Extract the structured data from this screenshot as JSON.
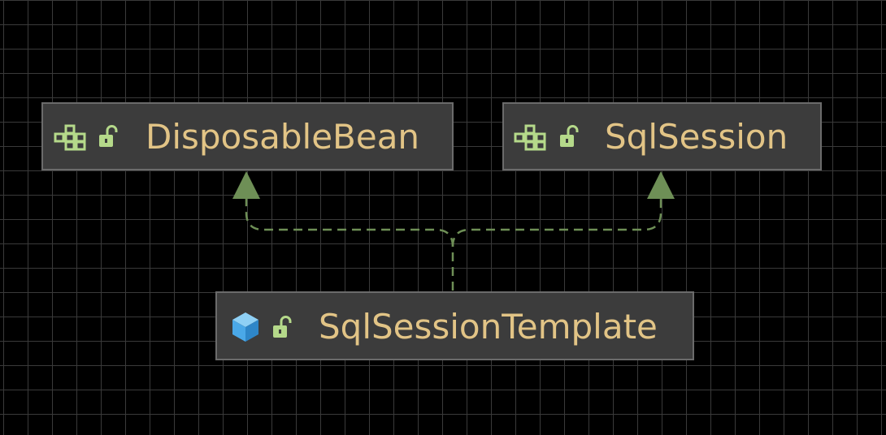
{
  "diagram": {
    "type": "uml-class-hierarchy",
    "nodes": [
      {
        "id": "disposable",
        "name": "DisposableBean",
        "kind": "interface",
        "kind_icon": "interface-icon",
        "visibility_icon": "unlocked-icon"
      },
      {
        "id": "sqlsession",
        "name": "SqlSession",
        "kind": "interface",
        "kind_icon": "interface-icon",
        "visibility_icon": "unlocked-icon"
      },
      {
        "id": "template",
        "name": "SqlSessionTemplate",
        "kind": "class",
        "kind_icon": "class-cube-icon",
        "visibility_icon": "unlocked-icon"
      }
    ],
    "edges": [
      {
        "from": "template",
        "to": "disposable",
        "relation": "implements",
        "style": "dashed"
      },
      {
        "from": "template",
        "to": "sqlsession",
        "relation": "implements",
        "style": "dashed"
      }
    ]
  },
  "colors": {
    "background": "#000000",
    "grid": "#3a3a3a",
    "node_fill": "#3c3c3c",
    "node_border": "#6b6b6b",
    "name_text": "#e2c486",
    "interface_icon": "#b5d98a",
    "class_icon": "#4aa8e8",
    "edge": "#6e8f56"
  }
}
